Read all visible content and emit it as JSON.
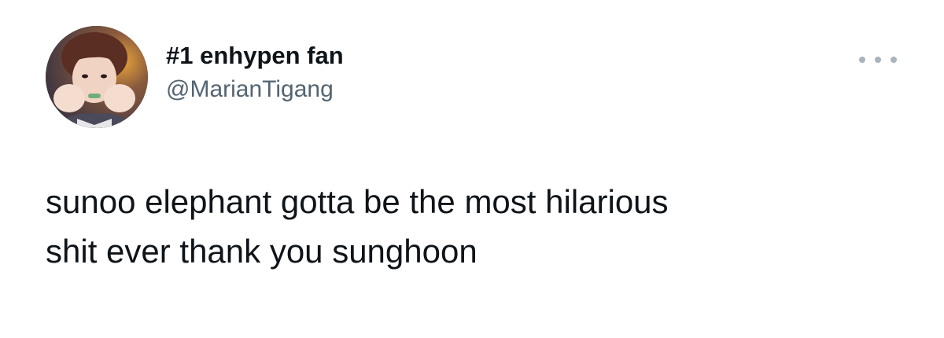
{
  "tweet": {
    "author": {
      "display_name": "#1 enhypen fan",
      "handle": "@MarianTigang",
      "avatar": "profile-photo"
    },
    "more_icon": "more-horizontal-icon",
    "text_line1": "sunoo elephant gotta be the most hilarious",
    "text_line2": "shit ever thank you sunghoon"
  },
  "colors": {
    "text": "#0f1419",
    "handle": "#536471",
    "more_dots": "#a9b4bd",
    "background": "#ffffff"
  }
}
